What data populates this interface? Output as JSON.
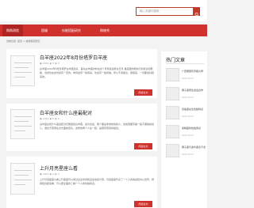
{
  "search": {
    "placeholder": "输入关键词搜索"
  },
  "nav": {
    "items": [
      {
        "label": "购购测验"
      },
      {
        "label": "国服"
      },
      {
        "label": "技能搭配研究"
      },
      {
        "label": "购物秀"
      }
    ]
  },
  "breadcrumb": "当前位置: 首页 > 技能搭配研究",
  "posts": [
    {
      "title": "白羊座2022年8月份塔罗白羊座",
      "meta": {
        "date": "2022",
        "views": "0",
        "comments": "0"
      },
      "excerpt": "白羊座2022年8月份塔罗白羊座您好，首先白羊座的你在这个月有些运势在日月 星座里的朋友们的建议和帮助，当然也在此时会有一定的，你将会有一些惊喜，也会有一些烦恼，所以不用着急，慢慢来，一切都会好起来的。",
      "more_label": "阅读全文"
    },
    {
      "title": "白羊座女和什么座最配对",
      "meta": {
        "date": "2022",
        "views": "0",
        "comments": "0"
      },
      "excerpt": "白羊座女和什么座最配对巨蟹座和白羊座，最为合适，两个都是非常热情的人，性格里都有着一股不服输的劲儿，谁也不愿意在对方面前低头，这样的两个人在一起，是很有意思的组合。",
      "more_label": "阅读全文"
    },
    {
      "title": "上升月亮星座么看",
      "meta": {
        "date": "2022",
        "views": "0",
        "comments": "0"
      },
      "excerpt": "上升月亮星座么看上升星座可以通过出生时间和出生地来计算，月亮星座代表了一个人的情感和内心世界，两者结合起来看，可以更全面的了解一个人的性格特点。",
      "more_label": "阅读全文"
    }
  ],
  "sidebar": {
    "title": "热门文章",
    "items": [
      {
        "title": "广西哪里有手相大师",
        "date": "2022-08-03"
      },
      {
        "title": "狮子座男生会爱白羊",
        "date": "2022-08-03"
      },
      {
        "title": "双鱼座女生性格特点",
        "date": "2022-08-03"
      },
      {
        "title": "摩羯座的性格弱点",
        "date": "2022-08-03"
      },
      {
        "title": "狮子座与金牛座合不合",
        "date": "2022-08-03"
      }
    ]
  }
}
